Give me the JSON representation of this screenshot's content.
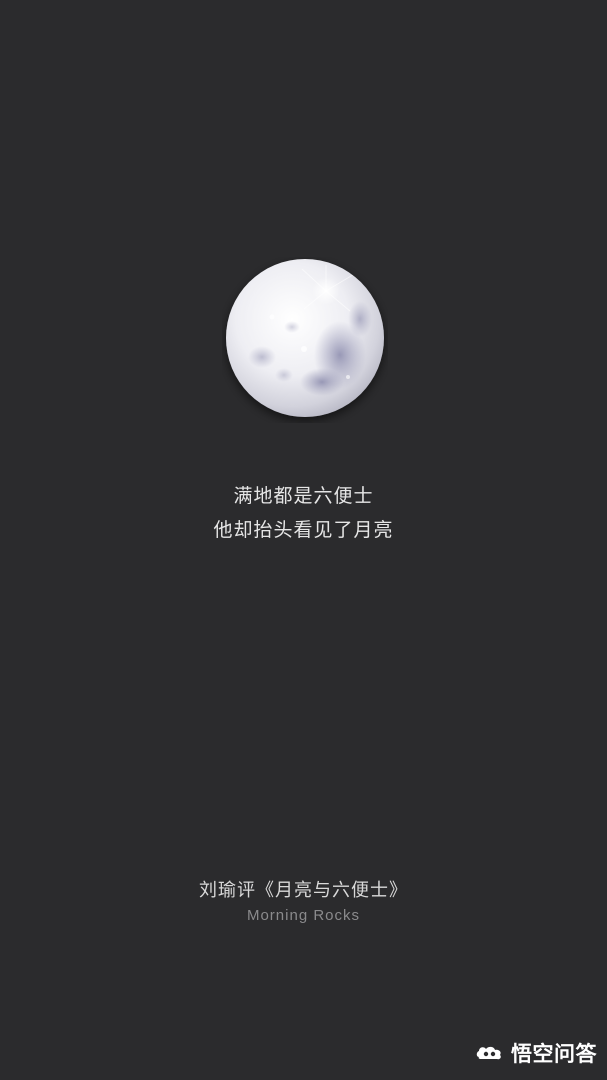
{
  "poem": {
    "line1": "满地都是六便士",
    "line2": "他却抬头看见了月亮"
  },
  "credit": {
    "title": "刘瑜评《月亮与六便士》",
    "subtitle": "Morning Rocks"
  },
  "watermark": {
    "logo": "wukong-cloud-logo",
    "text": "悟空问答"
  },
  "colors": {
    "background": "#2b2b2d",
    "text_primary": "#e6e6e6",
    "text_secondary": "#8a8a8c"
  }
}
